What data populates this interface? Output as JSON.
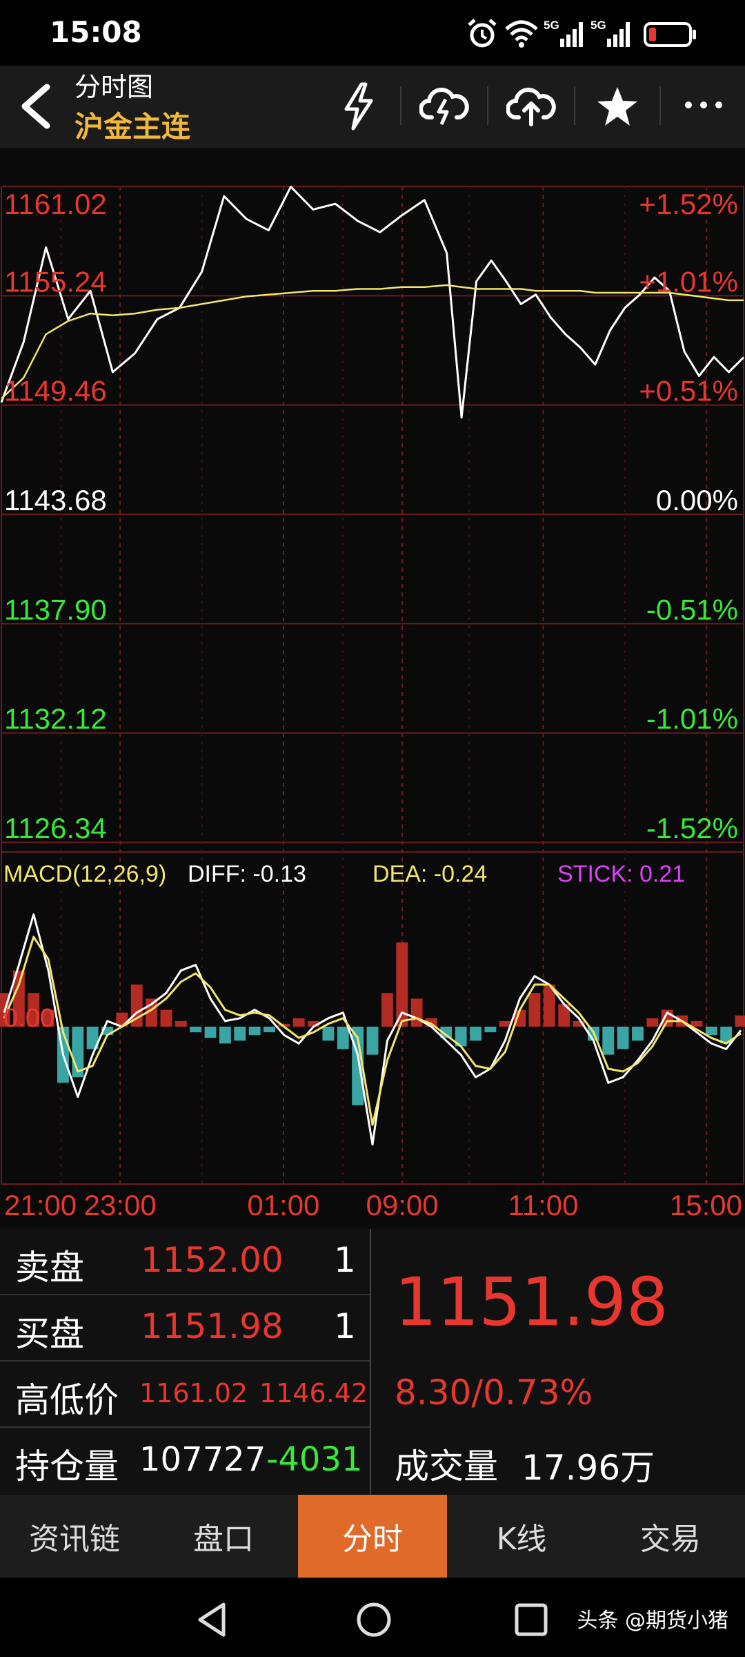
{
  "status_bar": {
    "time": "15:08",
    "icons": [
      "alarm-icon",
      "wifi-icon",
      "5g-signal-icon",
      "5g-signal-icon",
      "battery-low-icon"
    ],
    "signal_label": "5G"
  },
  "header": {
    "title": "分时图",
    "subtitle": "沪金主连",
    "actions": [
      "flash-icon",
      "cloud-download-icon",
      "cloud-upload-icon",
      "star-icon",
      "more-icon"
    ]
  },
  "price_axis": {
    "left": [
      "1161.02",
      "1155.24",
      "1149.46",
      "1143.68",
      "1137.90",
      "1132.12",
      "1126.34"
    ],
    "right": [
      "+1.52%",
      "+1.01%",
      "+0.51%",
      "0.00%",
      "-0.51%",
      "-1.01%",
      "-1.52%"
    ]
  },
  "macd": {
    "label": "MACD(12,26,9)",
    "diff": "DIFF: -0.13",
    "dea": "DEA: -0.24",
    "stick": "STICK: 0.21",
    "zero_label": "0.00"
  },
  "time_axis": [
    "21:00",
    "23:00",
    "01:00",
    "09:00",
    "11:00",
    "15:00"
  ],
  "quote": {
    "sell_label": "卖盘",
    "sell_price": "1152.00",
    "sell_qty": "1",
    "buy_label": "买盘",
    "buy_price": "1151.98",
    "buy_qty": "1",
    "hl_label": "高低价",
    "high": "1161.02",
    "low": "1146.42",
    "oi_label": "持仓量",
    "oi_value": "107727",
    "oi_change": "-4031",
    "last_price": "1151.98",
    "change": "8.30/0.73%",
    "volume_label": "成交量",
    "volume_value": "17.96万"
  },
  "tabs": [
    "资讯链",
    "盘口",
    "分时",
    "K线",
    "交易"
  ],
  "active_tab": "分时",
  "watermark": "头条 @期货小猪",
  "colors": {
    "up": "#e8372f",
    "down": "#39e839",
    "price_line": "#ffffff",
    "avg_line": "#f2e76a",
    "accent": "#e06a2a",
    "gold": "#f0b93a",
    "stick": "#e040fb",
    "grid": "#6a1c1c"
  },
  "chart_data": [
    {
      "type": "line",
      "title": "分时图",
      "xlabel": "",
      "ylabel": "",
      "x": [
        0,
        3,
        6,
        9,
        12,
        15,
        18,
        21,
        24,
        27,
        30,
        33,
        36,
        39,
        42,
        45,
        48,
        51,
        54,
        57,
        60,
        62,
        64,
        66,
        68,
        70,
        72,
        74,
        76,
        78,
        80,
        82,
        84,
        86,
        88,
        90,
        92,
        94,
        96,
        98,
        100
      ],
      "x_tick_labels": [
        "21:00",
        "23:00",
        "01:00",
        "09:00",
        "11:00",
        "15:00"
      ],
      "x_tick_positions": [
        0,
        16,
        38,
        54,
        73,
        95
      ],
      "ylim": [
        1126.34,
        1161.02
      ],
      "y_ticks": [
        1161.02,
        1155.24,
        1149.46,
        1143.68,
        1137.9,
        1132.12,
        1126.34
      ],
      "series": [
        {
          "values": [
            1149.6,
            1152.8,
            1157.8,
            1154.0,
            1155.5,
            1151.2,
            1152.2,
            1154.0,
            1154.6,
            1156.5,
            1160.5,
            1159.3,
            1158.7,
            1161.0,
            1159.8,
            1160.1,
            1159.2,
            1158.6,
            1159.5,
            1160.3,
            1157.5,
            1148.8,
            1156.0,
            1157.1,
            1156.0,
            1154.8,
            1155.3,
            1154.1,
            1153.2,
            1152.5,
            1151.6,
            1153.4,
            1154.6,
            1155.3,
            1156.2,
            1155.5,
            1152.3,
            1151.0,
            1152.0,
            1151.2,
            1151.98
          ]
        },
        {
          "values": [
            1149.8,
            1150.9,
            1153.2,
            1153.9,
            1154.3,
            1154.2,
            1154.3,
            1154.5,
            1154.6,
            1154.8,
            1155.0,
            1155.2,
            1155.3,
            1155.4,
            1155.5,
            1155.5,
            1155.6,
            1155.6,
            1155.7,
            1155.7,
            1155.8,
            1155.7,
            1155.6,
            1155.6,
            1155.6,
            1155.6,
            1155.5,
            1155.5,
            1155.5,
            1155.5,
            1155.4,
            1155.4,
            1155.4,
            1155.4,
            1155.4,
            1155.4,
            1155.3,
            1155.2,
            1155.1,
            1155.0,
            1155.0
          ]
        }
      ]
    },
    {
      "type": "bar",
      "title": "MACD(12,26,9)",
      "xlabel": "",
      "ylabel": "",
      "ylim": [
        -4.6,
        4.6
      ],
      "series": [
        {
          "name": "STICK",
          "values": [
            1.2,
            2.0,
            1.2,
            0.6,
            -2.0,
            -1.8,
            -0.8,
            -0.3,
            0.5,
            1.5,
            1.0,
            0.6,
            0.2,
            -0.2,
            -0.4,
            -0.6,
            -0.5,
            -0.3,
            -0.2,
            0.1,
            0.3,
            0.2,
            -0.5,
            -0.8,
            -2.8,
            -1.0,
            1.2,
            3.0,
            1.0,
            0.3,
            -0.4,
            -0.7,
            -0.5,
            -0.2,
            0.2,
            0.6,
            1.2,
            1.5,
            0.8,
            0.2,
            -0.5,
            -1.0,
            -0.8,
            -0.5,
            0.3,
            0.6,
            0.4,
            0.2,
            -0.3,
            -0.6,
            0.4
          ]
        },
        {
          "name": "DIFF",
          "values": [
            0.5,
            2.2,
            4.0,
            2.0,
            -1.0,
            -2.5,
            -1.0,
            0.2,
            0.0,
            0.5,
            0.8,
            1.2,
            2.0,
            2.2,
            1.0,
            0.2,
            0.3,
            0.6,
            0.3,
            -0.3,
            -0.6,
            0.0,
            0.3,
            0.5,
            -1.0,
            -4.2,
            -0.5,
            0.5,
            0.3,
            0.0,
            -0.5,
            -1.0,
            -1.8,
            -1.5,
            -0.5,
            1.0,
            1.8,
            1.5,
            0.8,
            0.3,
            -0.5,
            -2.0,
            -1.8,
            -1.2,
            -0.5,
            0.5,
            0.2,
            -0.2,
            -0.6,
            -0.8,
            -0.13
          ]
        },
        {
          "name": "DEA",
          "values": [
            0.3,
            1.5,
            3.2,
            2.4,
            -0.2,
            -1.6,
            -1.4,
            -0.3,
            0.0,
            0.3,
            0.6,
            1.0,
            1.6,
            1.9,
            1.4,
            0.6,
            0.4,
            0.5,
            0.4,
            0.0,
            -0.4,
            -0.2,
            0.1,
            0.3,
            -0.4,
            -3.5,
            -1.2,
            0.2,
            0.3,
            0.1,
            -0.3,
            -0.7,
            -1.4,
            -1.5,
            -0.9,
            0.6,
            1.5,
            1.5,
            1.0,
            0.5,
            -0.2,
            -1.5,
            -1.6,
            -1.3,
            -0.7,
            0.2,
            0.2,
            -0.1,
            -0.4,
            -0.6,
            -0.24
          ]
        }
      ]
    }
  ]
}
